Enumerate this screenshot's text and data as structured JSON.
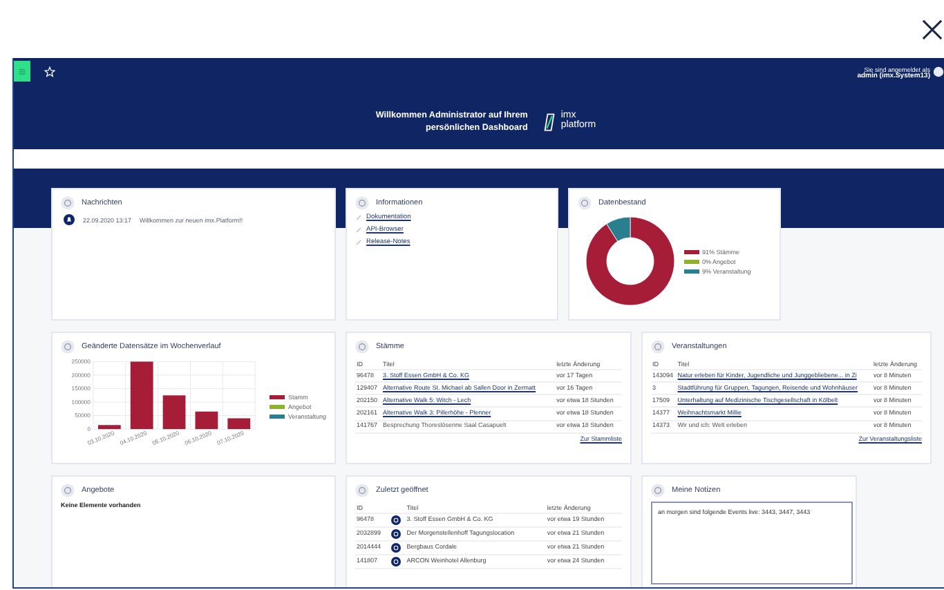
{
  "header": {
    "user_label": "Sie sind angemeldet als",
    "user_name": "admin (imx.System13)",
    "welcome_lines": [
      "Willkommen Administrator auf Ihrem",
      "persönlichen Dashboard"
    ],
    "logo_lines": [
      "imx",
      "platform"
    ]
  },
  "rows": [
    [
      {
        "kind": "messages",
        "title": "Nachrichten",
        "items": [
          {
            "date": "22.09.2020 13:17",
            "text": "Willkommen zur neuen imx.Platform!!"
          }
        ]
      },
      {
        "kind": "links",
        "title": "Informationen",
        "links": [
          "Dokumentation",
          "API-Browser",
          "Release-Notes"
        ]
      },
      {
        "kind": "chart",
        "title": "Datenbestand",
        "chart_data": {
          "type": "donut",
          "categories": [
            "91% Stämme",
            "0% Angebot",
            "9% Veranstaltung"
          ],
          "values": [
            91,
            0,
            9
          ],
          "colors": [
            "#a51d36",
            "#8db32a",
            "#2a7f8e"
          ],
          "legend": "right"
        }
      }
    ],
    [
      {
        "kind": "chart",
        "title": "Geänderte Datensätze im Wochenverlauf",
        "chart_data": {
          "type": "bar",
          "categories": [
            "03.10.2020",
            "04.10.2020",
            "05.10.2020",
            "06.10.2020",
            "07.10.2020"
          ],
          "series": [
            {
              "name": "Stamm",
              "color": "#a51d36",
              "values": [
                15000,
                250000,
                125000,
                65000,
                40000
              ]
            },
            {
              "name": "Angebot",
              "color": "#8db32a",
              "values": [
                0,
                0,
                0,
                0,
                0
              ]
            },
            {
              "name": "Veranstaltung",
              "color": "#2a7f8e",
              "values": [
                0,
                0,
                0,
                0,
                0
              ]
            }
          ],
          "ylim": [
            0,
            250000
          ],
          "yticks": [
            0,
            50000,
            100000,
            150000,
            200000,
            250000
          ],
          "grid": true,
          "legend": "right"
        }
      },
      {
        "kind": "table",
        "title": "Stämme",
        "columns": [
          "ID",
          "Titel",
          "letzte Änderung"
        ],
        "rows": [
          {
            "id": "96478",
            "title": "3. Stoff Essen GmbH & Co. KG",
            "changed": "vor 17 Tagen",
            "link": true
          },
          {
            "id": "129407",
            "title": "Alternative Route St. Michael ab Sallen Door in Zermatt",
            "changed": "vor 16 Tagen",
            "link": true
          },
          {
            "id": "202150",
            "title": "Alternative Walk 5: Witch - Lech",
            "changed": "vor etwa 18 Stunden",
            "link": true
          },
          {
            "id": "202161",
            "title": "Alternative Walk 3: Pillerhöhe - Plenner",
            "changed": "vor etwa 18 Stunden",
            "link": true
          },
          {
            "id": "141767",
            "title": "Besprechung Thoreslösenne Saal Casapuelt",
            "changed": "vor etwa 18 Stunden",
            "link": false
          }
        ],
        "more": "Zur Stammliste"
      },
      {
        "kind": "table",
        "title": "Veranstaltungen",
        "columns": [
          "ID",
          "Titel",
          "letzte Änderung"
        ],
        "rows": [
          {
            "id": "143094",
            "title": "Natur erleben für Kinder, Jugendliche und Junggebliebene... in Zi",
            "changed": "vor 8 Minuten",
            "link": true
          },
          {
            "id": "3",
            "title": "Stadtführung für Gruppen, Tagungen, Reisende und Wohnhäuser",
            "changed": "vor 8 Minuten",
            "link": true
          },
          {
            "id": "17509",
            "title": "Unterhaltung auf Medizinische Tischgesellschaft in Kölbelt",
            "changed": "vor 8 Minuten",
            "link": true
          },
          {
            "id": "14377",
            "title": "Weihnachtsmarkt Millie",
            "changed": "vor 8 Minuten",
            "link": true
          },
          {
            "id": "14373",
            "title": "Wir und ich: Welt erleben",
            "changed": "vor 8 Minuten",
            "link": false
          }
        ],
        "more": "Zur Veranstaltungsliste"
      }
    ],
    [
      {
        "kind": "empty",
        "title": "Angebote",
        "text": "Keine Elemente vorhanden"
      },
      {
        "kind": "recent",
        "title": "Zuletzt geöffnet",
        "columns": [
          "ID",
          "Titel",
          "letzte Änderung"
        ],
        "rows": [
          {
            "id": "96478",
            "title": "3. Stoff Essen GmbH & Co. KG",
            "changed": "vor etwa 19 Stunden"
          },
          {
            "id": "2032899",
            "title": "Der Morgenstellenhoff Tagungslocation",
            "changed": "vor etwa 21 Stunden"
          },
          {
            "id": "2014444",
            "title": "Bergbaus Cordale",
            "changed": "vor etwa 21 Stunden"
          },
          {
            "id": "141807",
            "title": "ARCON Weinhotel Allenburg",
            "changed": "vor etwa 24 Stunden"
          }
        ]
      },
      {
        "kind": "notes",
        "title": "Meine Notizen",
        "value": "an morgen sind folgende Events live: 3443, 3447, 3443"
      }
    ]
  ]
}
